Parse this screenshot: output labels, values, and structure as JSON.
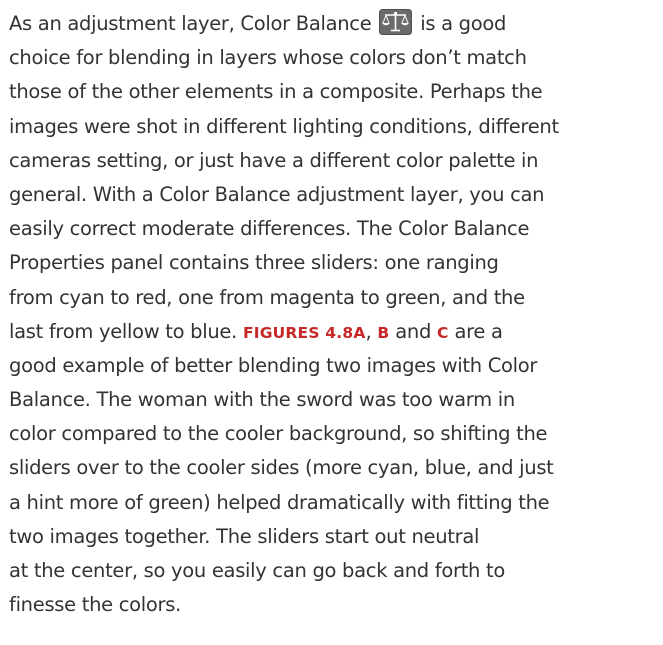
{
  "page_text": {
    "line1_before_icon": "As an adjustment layer, Color Balance ",
    "line1_after_icon": " is a good",
    "line2": "choice for blending in layers whose colors don’t match",
    "line3": "those of the other elements in a composite. Perhaps the",
    "line4": "images were shot in different lighting conditions, different",
    "line5": "cameras setting, or just have a different color palette in",
    "line6": "general. With a Color Balance adjustment layer, you can",
    "line7": "easily correct moderate differences. The Color Balance",
    "line8": "Properties panel contains three sliders: one ranging",
    "line9": "from cyan to red, one from magenta to green, and the",
    "line10_before_ref": "last from yellow to blue. ",
    "fig_ref_main": "FIGURES 4.8A",
    "fig_ref_sep1": ", ",
    "fig_ref_b": "B",
    "fig_ref_sep2": " and ",
    "fig_ref_c": "C",
    "line10_after_ref": " are a",
    "line11": "good example of better blending two images with Color",
    "line12": "Balance. The woman with the sword was too warm in",
    "line13": "color compared to the cooler background, so shifting the",
    "line14": "sliders over to the cooler sides (more cyan, blue, and just",
    "line15": "a hint more of green) helped dramatically with fitting the",
    "line16": "two images together. The sliders start out neutral",
    "line17": "at the center, so you easily can go back and forth to",
    "line18": "finesse the colors."
  },
  "icons": {
    "inline_icon": "color-balance-scale-icon"
  },
  "colors": {
    "text": "#333333",
    "figure_reference": "#c62828",
    "icon_background": "#6b6b6b",
    "icon_glyph": "#ffffff"
  }
}
